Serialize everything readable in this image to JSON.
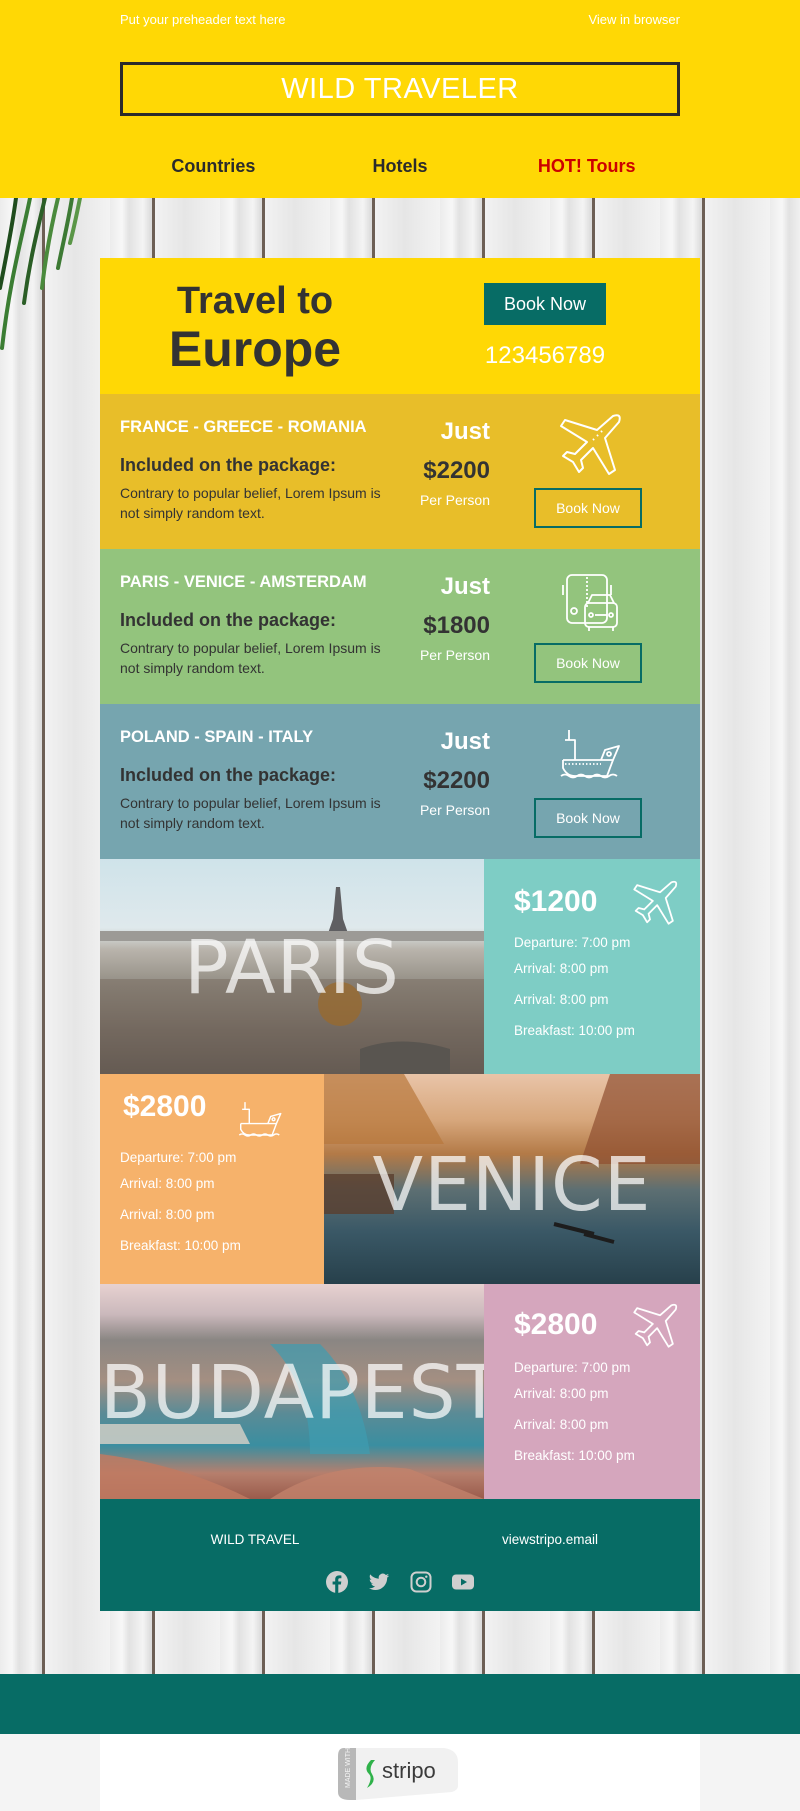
{
  "header": {
    "preheader": "Put your preheader text here",
    "view_in_browser": "View in browser",
    "logo": "WILD TRAVELER",
    "nav": [
      {
        "label": "Countries"
      },
      {
        "label": "Hotels"
      },
      {
        "label": "HOT! Tours",
        "color": "#cc0000"
      }
    ]
  },
  "hero": {
    "title_line1": "Travel to",
    "title_line2": "Europe",
    "book_label": "Book Now",
    "phone": "123456789"
  },
  "packages": [
    {
      "route": "FRANCE - GREECE - ROMANIA",
      "included": "Included on the package:",
      "description": "Contrary to popular belief, Lorem Ipsum is not simply random text.",
      "just": "Just",
      "price": "$2200",
      "per": "Per Person",
      "icon": "airplane-icon",
      "book_label": "Book Now",
      "bg": "#e8be29"
    },
    {
      "route": "PARIS - VENICE - AMSTERDAM",
      "included": "Included on the package:",
      "description": "Contrary to popular belief, Lorem Ipsum is not simply random text.",
      "just": "Just",
      "price": "$1800",
      "per": "Per Person",
      "icon": "bus-car-icon",
      "book_label": "Book Now",
      "bg": "#93c47d"
    },
    {
      "route": "POLAND - SPAIN - ITALY",
      "included": "Included on the package:",
      "description": "Contrary to popular belief, Lorem Ipsum is not simply random text.",
      "just": "Just",
      "price": "$2200",
      "per": "Per Person",
      "icon": "ship-icon",
      "book_label": "Book Now",
      "bg": "#76a5af"
    }
  ],
  "cities": [
    {
      "name": "PARIS",
      "price": "$1200",
      "icon": "airplane-icon",
      "info_bg": "#7ecdc5",
      "lines": [
        "Departure: 7:00 pm",
        "Arrival: 8:00 pm",
        "Arrival: 8:00 pm",
        "Breakfast: 10:00 pm"
      ]
    },
    {
      "name": "VENICE",
      "price": "$2800",
      "icon": "ship-icon",
      "info_bg": "#f6b26b",
      "lines": [
        "Departure: 7:00 pm",
        "Arrival: 8:00 pm",
        "Arrival: 8:00 pm",
        "Breakfast: 10:00 pm"
      ]
    },
    {
      "name": "BUDAPEST",
      "price": "$2800",
      "icon": "airplane-icon",
      "info_bg": "#d5a6bd",
      "lines": [
        "Departure: 7:00 pm",
        "Arrival: 8:00 pm",
        "Arrival: 8:00 pm",
        "Breakfast: 10:00 pm"
      ]
    }
  ],
  "footer": {
    "brand": "WILD TRAVEL",
    "site": "viewstripo.email",
    "socials": [
      "facebook",
      "twitter",
      "instagram",
      "youtube"
    ]
  },
  "badge": {
    "made_with": "MADE WITH",
    "brand": "stripo"
  },
  "colors": {
    "yellow": "#ffd805",
    "teal": "#076c65",
    "hot": "#cc0000",
    "dark_text": "#333333"
  }
}
